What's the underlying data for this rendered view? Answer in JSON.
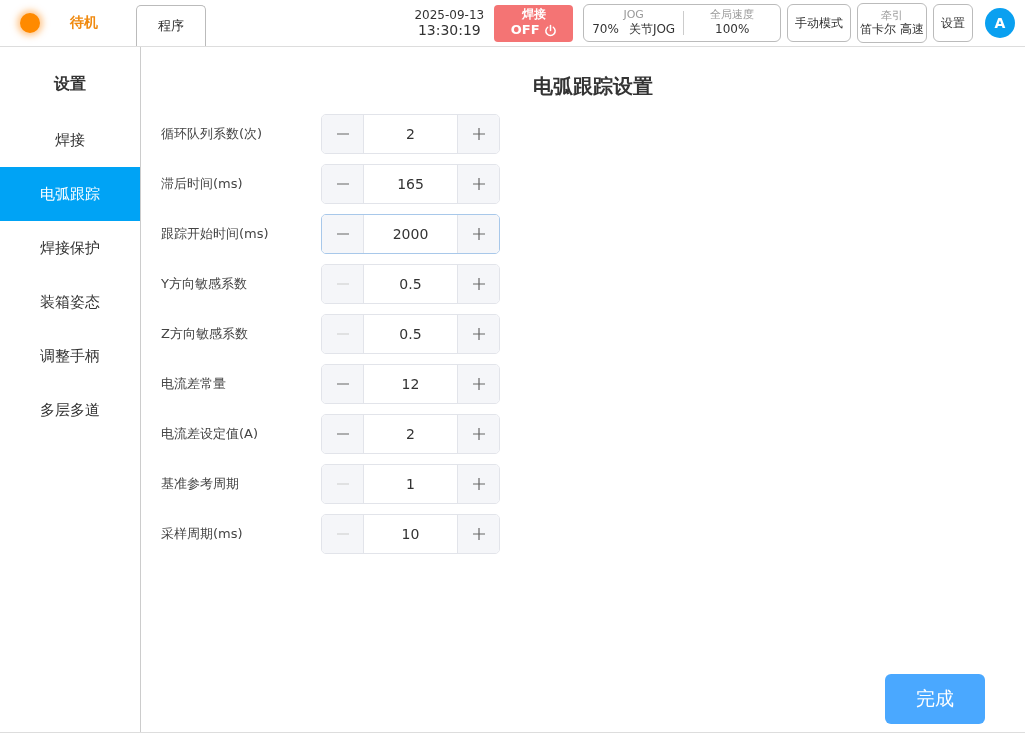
{
  "header": {
    "status": "待机",
    "program_tab": {
      "label": "程序"
    },
    "date": "2025-09-13",
    "time": "13:30:19",
    "weld_button": {
      "label": "焊接",
      "state": "OFF",
      "on": false
    },
    "jog": {
      "title": "JOG",
      "value": "70%",
      "mode": "关节JOG"
    },
    "speed": {
      "title": "全局速度",
      "value": "100%"
    },
    "mode_button": "手动模式",
    "traction": {
      "title": "牵引",
      "value": "笛卡尔 高速"
    },
    "settings_button": "设置",
    "avatar": "A"
  },
  "sidebar": {
    "title": "设置",
    "items": [
      {
        "label": "焊接",
        "selected": false
      },
      {
        "label": "电弧跟踪",
        "selected": true
      },
      {
        "label": "焊接保护",
        "selected": false
      },
      {
        "label": "装箱姿态",
        "selected": false
      },
      {
        "label": "调整手柄",
        "selected": false
      },
      {
        "label": "多层多道",
        "selected": false
      }
    ]
  },
  "page_title": "电弧跟踪设置",
  "params": [
    {
      "label": "循环队列系数(次)",
      "value": "2",
      "minus_disabled": false,
      "focused": false
    },
    {
      "label": "滞后时间(ms)",
      "value": "165",
      "minus_disabled": false,
      "focused": false
    },
    {
      "label": "跟踪开始时间(ms)",
      "value": "2000",
      "minus_disabled": false,
      "focused": true
    },
    {
      "label": "Y方向敏感系数",
      "value": "0.5",
      "minus_disabled": true,
      "focused": false
    },
    {
      "label": "Z方向敏感系数",
      "value": "0.5",
      "minus_disabled": true,
      "focused": false
    },
    {
      "label": "电流差常量",
      "value": "12",
      "minus_disabled": false,
      "focused": false
    },
    {
      "label": "电流差设定值(A)",
      "value": "2",
      "minus_disabled": false,
      "focused": false
    },
    {
      "label": "基准参考周期",
      "value": "1",
      "minus_disabled": true,
      "focused": false
    },
    {
      "label": "采样周期(ms)",
      "value": "10",
      "minus_disabled": true,
      "focused": false
    }
  ],
  "done_button": "完成"
}
